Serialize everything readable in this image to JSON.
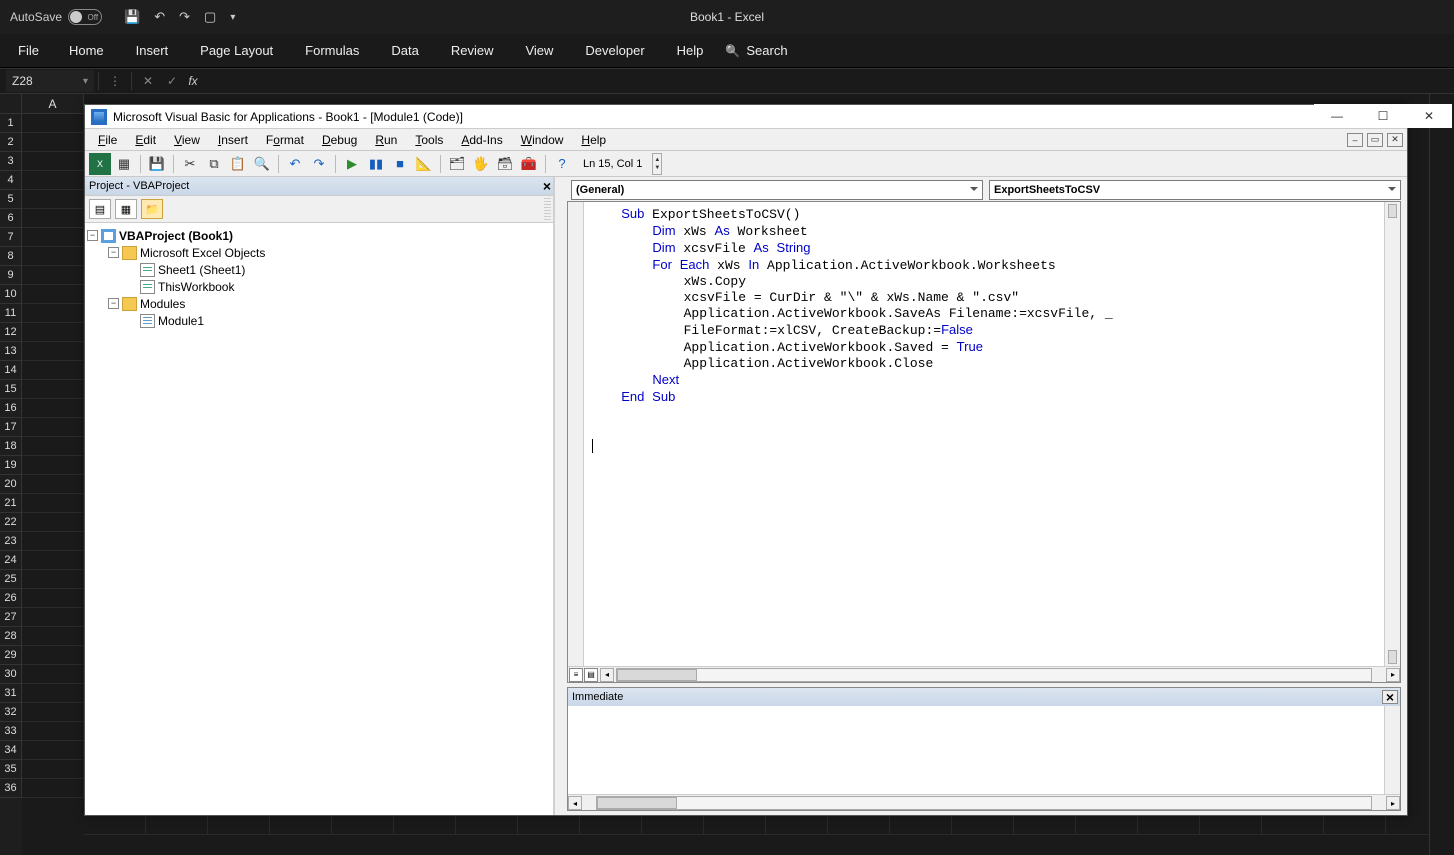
{
  "excel": {
    "autosave_label": "AutoSave",
    "autosave_state": "Off",
    "title": "Book1 - Excel",
    "ribbon_tabs": [
      "File",
      "Home",
      "Insert",
      "Page Layout",
      "Formulas",
      "Data",
      "Review",
      "View",
      "Developer",
      "Help"
    ],
    "search_label": "Search",
    "namebox_value": "Z28",
    "column_header": "A",
    "row_count": 36
  },
  "vba": {
    "title": "Microsoft Visual Basic for Applications - Book1 - [Module1 (Code)]",
    "menus": [
      "File",
      "Edit",
      "View",
      "Insert",
      "Format",
      "Debug",
      "Run",
      "Tools",
      "Add-Ins",
      "Window",
      "Help"
    ],
    "cursor_pos": "Ln 15, Col 1",
    "project_pane_title": "Project - VBAProject",
    "tree": {
      "root": "VBAProject (Book1)",
      "folder1": "Microsoft Excel Objects",
      "sheet1": "Sheet1 (Sheet1)",
      "thiswb": "ThisWorkbook",
      "folder2": "Modules",
      "module1": "Module1"
    },
    "dd_left": "(General)",
    "dd_right": "ExportSheetsToCSV",
    "immediate_title": "Immediate",
    "code_lines": [
      {
        "i": 0,
        "t": "Sub ExportSheetsToCSV()",
        "kw": [
          "Sub"
        ]
      },
      {
        "i": 1,
        "t": "Dim xWs As Worksheet",
        "kw": [
          "Dim",
          "As"
        ]
      },
      {
        "i": 1,
        "t": "Dim xcsvFile As String",
        "kw": [
          "Dim",
          "As",
          "String"
        ]
      },
      {
        "i": 1,
        "t": "For Each xWs In Application.ActiveWorkbook.Worksheets",
        "kw": [
          "For",
          "Each",
          "In"
        ]
      },
      {
        "i": 2,
        "t": "xWs.Copy",
        "kw": []
      },
      {
        "i": 2,
        "t": "xcsvFile = CurDir & \"\\\" & xWs.Name & \".csv\"",
        "kw": []
      },
      {
        "i": 2,
        "t": "Application.ActiveWorkbook.SaveAs Filename:=xcsvFile, _",
        "kw": []
      },
      {
        "i": 2,
        "t": "FileFormat:=xlCSV, CreateBackup:=False",
        "kw": [
          "False"
        ]
      },
      {
        "i": 2,
        "t": "Application.ActiveWorkbook.Saved = True",
        "kw": [
          "True"
        ]
      },
      {
        "i": 2,
        "t": "Application.ActiveWorkbook.Close",
        "kw": []
      },
      {
        "i": 1,
        "t": "Next",
        "kw": [
          "Next"
        ]
      },
      {
        "i": 0,
        "t": "End Sub",
        "kw": [
          "End",
          "Sub"
        ]
      }
    ]
  }
}
